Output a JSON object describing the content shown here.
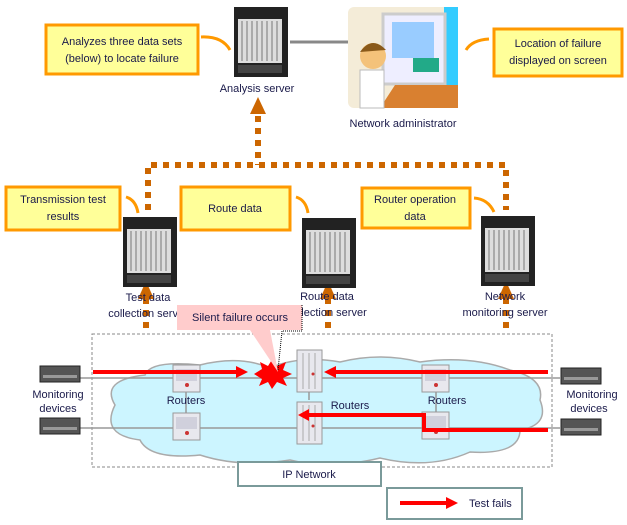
{
  "colors": {
    "flow": "#cc6600",
    "callout_fill": "#ffff99",
    "callout_border": "#ff9900",
    "failure": "#ff0000",
    "cloud": "#ccf5ff",
    "failure_callout": "#ffcccc"
  },
  "top": {
    "analysis_callout": [
      "Analyzes three data sets",
      "(below) to locate failure"
    ],
    "analysis_server": "Analysis server",
    "administrator": "Network administrator",
    "screen_callout": [
      "Location of failure",
      "displayed on screen"
    ]
  },
  "middle": {
    "transmission_callout": [
      "Transmission test",
      "results"
    ],
    "route_callout": "Route data",
    "router_op_callout": [
      "Router operation",
      "data"
    ],
    "test_server": [
      "Test data",
      "collection server"
    ],
    "route_server": [
      "Route data",
      "collection server"
    ],
    "monitoring_server": [
      "Network",
      "monitoring server"
    ]
  },
  "network": {
    "silent_failure": "Silent failure occurs",
    "routers": "Routers",
    "monitoring_devices": [
      "Monitoring",
      "devices"
    ],
    "ip_network": "IP Network"
  },
  "legend": {
    "test_fails": "Test fails"
  }
}
